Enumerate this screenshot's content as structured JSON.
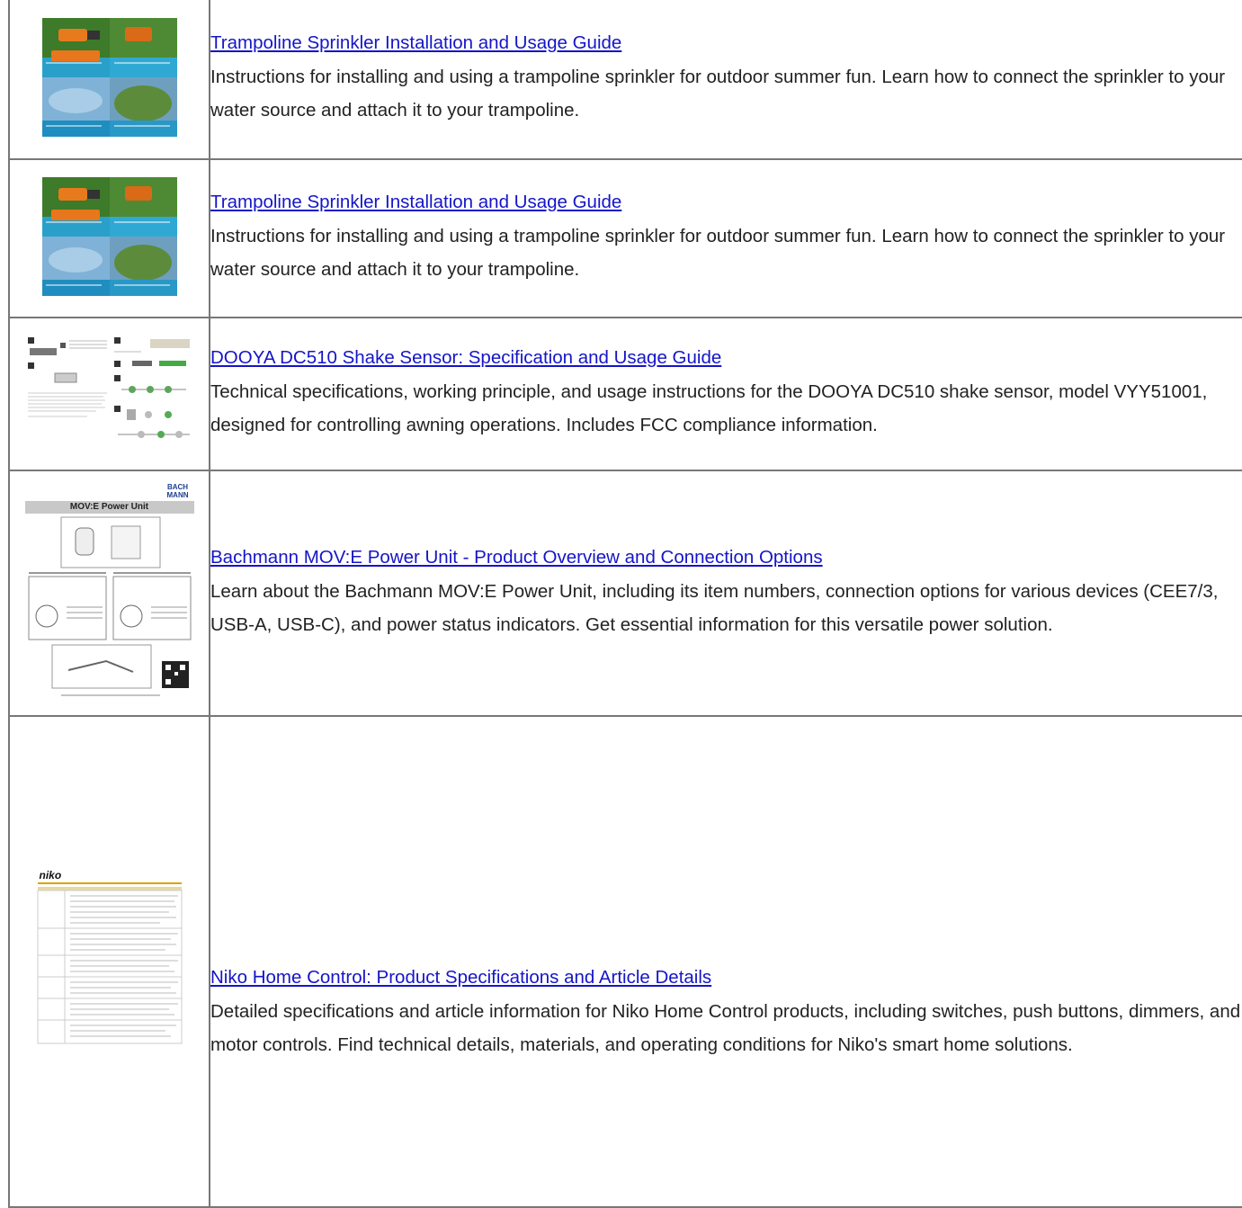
{
  "items": [
    {
      "title": "Trampoline Sprinkler Installation and Usage Guide",
      "description": "Instructions for installing and using a trampoline sprinkler for outdoor summer fun. Learn how to connect the sprinkler to your water source and attach it to your trampoline."
    },
    {
      "title": "Trampoline Sprinkler Installation and Usage Guide",
      "description": "Instructions for installing and using a trampoline sprinkler for outdoor summer fun. Learn how to connect the sprinkler to your water source and attach it to your trampoline."
    },
    {
      "title": "DOOYA DC510 Shake Sensor: Specification and Usage Guide",
      "description": "Technical specifications, working principle, and usage instructions for the DOOYA DC510 shake sensor, model VYY51001, designed for controlling awning operations. Includes FCC compliance information."
    },
    {
      "title": "Bachmann MOV:E Power Unit - Product Overview and Connection Options",
      "description": "Learn about the Bachmann MOV:E Power Unit, including its item numbers, connection options for various devices (CEE7/3, USB-A, USB-C), and power status indicators. Get essential information for this versatile power solution."
    },
    {
      "title": "Niko Home Control: Product Specifications and Article Details",
      "description": "Detailed specifications and article information for Niko Home Control products, including switches, push buttons, dimmers, and motor controls. Find technical details, materials, and operating conditions for Niko's smart home solutions."
    }
  ],
  "thumbnails": {
    "bachmann_logo": "BACH MANN",
    "bachmann_heading": "MOV:E Power Unit",
    "niko_logo": "niko"
  },
  "colors": {
    "link": "#1515c8",
    "border": "#777777"
  }
}
